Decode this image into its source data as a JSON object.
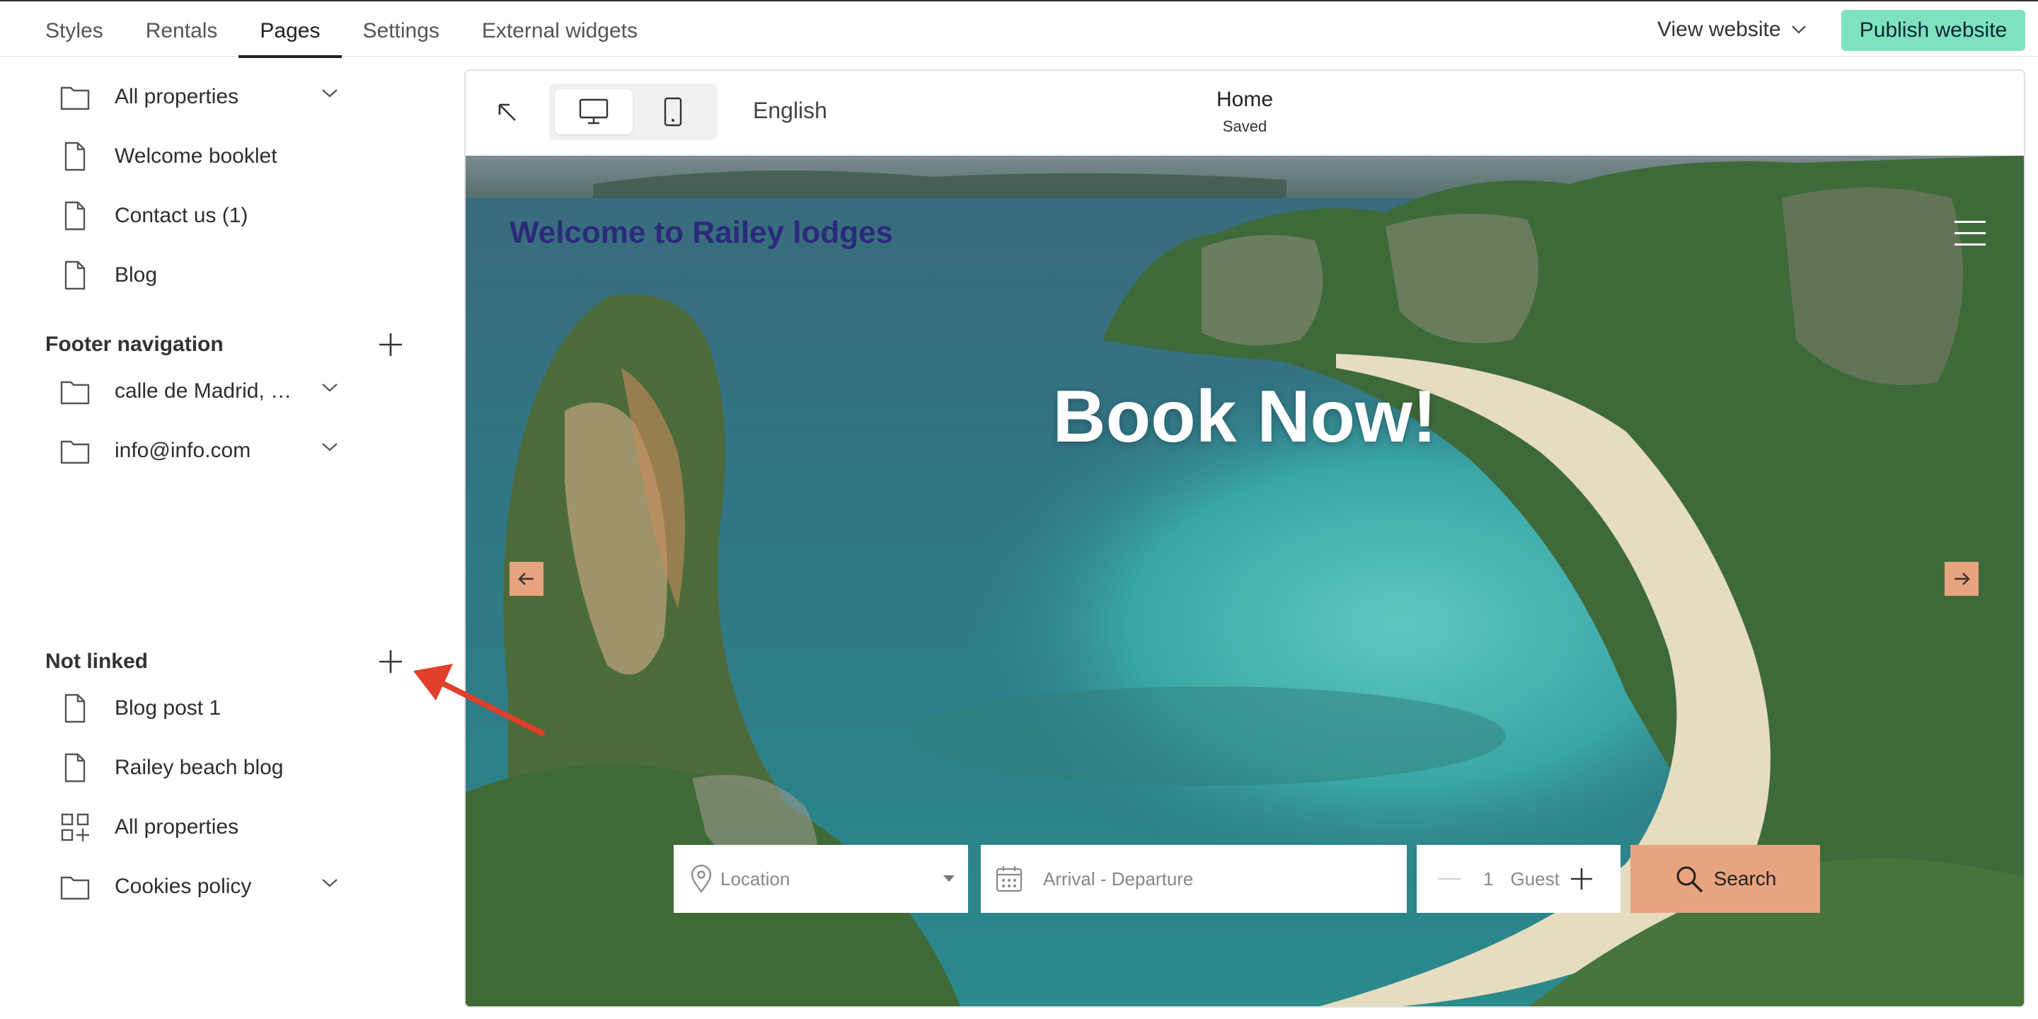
{
  "topbar": {
    "tabs": [
      "Styles",
      "Rentals",
      "Pages",
      "Settings",
      "External widgets"
    ],
    "active_tab": "Pages",
    "view_website": "View website",
    "publish": "Publish website"
  },
  "sidebar": {
    "main_items": [
      {
        "label": "All properties",
        "icon": "folder-icon",
        "expandable": true
      },
      {
        "label": "Welcome booklet",
        "icon": "page-icon",
        "expandable": false
      },
      {
        "label": "Contact us (1)",
        "icon": "page-icon",
        "expandable": false
      },
      {
        "label": "Blog",
        "icon": "page-icon",
        "expandable": false
      }
    ],
    "footer_title": "Footer navigation",
    "footer_items": [
      {
        "label": "calle de Madrid, …",
        "icon": "folder-icon",
        "expandable": true
      },
      {
        "label": "info@info.com",
        "icon": "folder-icon",
        "expandable": true
      }
    ],
    "not_linked_title": "Not linked",
    "not_linked_items": [
      {
        "label": "Blog post 1",
        "icon": "page-icon",
        "expandable": false
      },
      {
        "label": "Railey beach blog",
        "icon": "page-icon",
        "expandable": false
      },
      {
        "label": "All properties",
        "icon": "grid-icon",
        "expandable": false
      },
      {
        "label": "Cookies policy",
        "icon": "folder-icon",
        "expandable": true
      }
    ]
  },
  "preview": {
    "language": "English",
    "page_name": "Home",
    "page_status": "Saved",
    "site_title": "Welcome to Railey lodges",
    "headline": "Book Now!",
    "search": {
      "location_placeholder": "Location",
      "dates_placeholder": "Arrival - Departure",
      "guest_count": "1",
      "guest_label": "Guest",
      "button": "Search"
    }
  },
  "colors": {
    "publish_bg": "#7ee2bf",
    "accent": "#e8a37f",
    "site_title": "#2b2a7a",
    "annotation": "#e0402a"
  }
}
